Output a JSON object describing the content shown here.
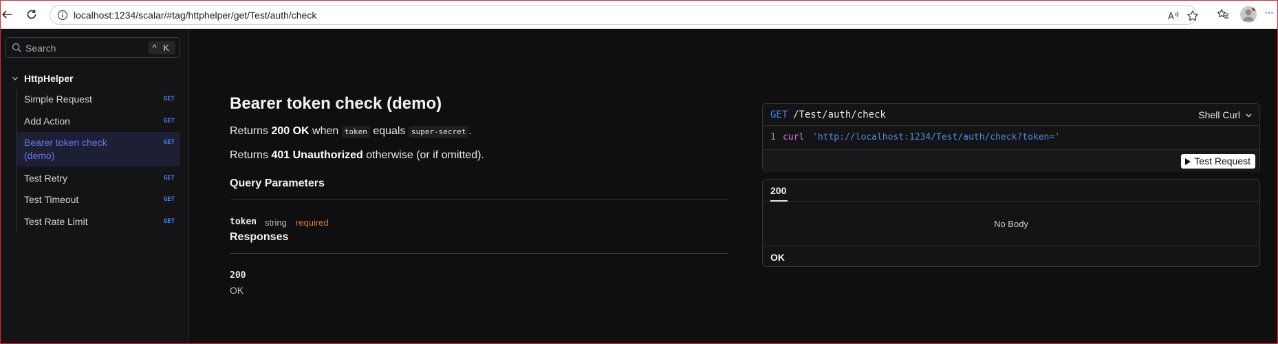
{
  "browser": {
    "url": "localhost:1234/scalar/#tag/httphelper/get/Test/auth/check"
  },
  "sidebar": {
    "search": {
      "placeholder": "Search",
      "shortcut": "^ K"
    },
    "group": {
      "title": "HttpHelper",
      "items": [
        {
          "label": "Simple Request",
          "method": "GET"
        },
        {
          "label": "Add Action",
          "method": "GET"
        },
        {
          "label": "Bearer token check (demo)",
          "method": "GET",
          "active": true
        },
        {
          "label": "Test Retry",
          "method": "GET"
        },
        {
          "label": "Test Timeout",
          "method": "GET"
        },
        {
          "label": "Test Rate Limit",
          "method": "GET"
        }
      ]
    }
  },
  "endpoint": {
    "title": "Bearer token check (demo)",
    "desc1": {
      "a": "Returns ",
      "b": "200 OK",
      "c": " when ",
      "code1": "token",
      "d": " equals ",
      "code2": "super-secret",
      "e": "."
    },
    "desc2": {
      "a": "Returns ",
      "b": "401 Unauthorized",
      "c": " otherwise (or if omitted)."
    },
    "query_title": "Query Parameters",
    "param": {
      "name": "token",
      "type": "string",
      "required": "required"
    },
    "responses_title": "Responses",
    "response": {
      "code": "200",
      "desc": "OK"
    }
  },
  "request_card": {
    "method": "GET",
    "path": "/Test/auth/check",
    "client": "Shell Curl",
    "line_number": "1",
    "code_keyword": "curl",
    "code_url": "'http://localhost:1234/Test/auth/check?token='",
    "test_button": "Test Request"
  },
  "response_card": {
    "tab": "200",
    "body": "No Body",
    "status": "OK"
  },
  "colors": {
    "accent_get": "#3f84ee",
    "active_nav": "#6576ef",
    "required": "#e07a2e",
    "background": "#0f0f10"
  }
}
